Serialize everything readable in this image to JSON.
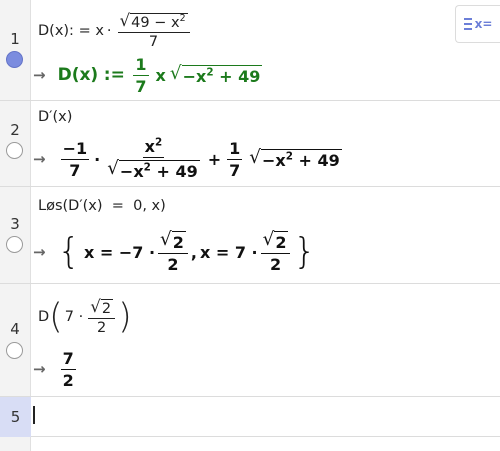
{
  "toolbar": {
    "toggle_label": "x="
  },
  "rows": [
    {
      "number": "1",
      "input": {
        "prefix": "D(x):",
        "eq": "=",
        "x": "x",
        "dot": "·",
        "sqrt_body": "49 − x",
        "sqrt_exp": "2",
        "den": "7"
      },
      "output": {
        "lhs": "D(x)",
        "assign": ":=",
        "num": "1",
        "den": "7",
        "x": "x",
        "sqrt_body": "−x",
        "sqrt_exp": "2",
        "sqrt_tail": " + 49"
      }
    },
    {
      "number": "2",
      "input": {
        "text": "D′(x)"
      },
      "output": {
        "num1": "−1",
        "den1": "7",
        "dot": "·",
        "num2": "x",
        "num2_exp": "2",
        "den2_body": "−x",
        "den2_exp": "2",
        "den2_tail": " + 49",
        "plus": "+",
        "num3": "1",
        "den3": "7",
        "sqrt_body": "−x",
        "sqrt_exp": "2",
        "sqrt_tail": " + 49"
      }
    },
    {
      "number": "3",
      "input": {
        "text": "Løs(D′(x)  =  0, x)"
      },
      "output": {
        "open": "{",
        "a": "x = −7 ·",
        "sqrt1": "2",
        "den1": "2",
        "comma": ",",
        "b": "x = 7 ·",
        "sqrt2": "2",
        "den2": "2",
        "close": "}"
      }
    },
    {
      "number": "4",
      "input": {
        "fn": "D",
        "open": "(",
        "seven": "7 ·",
        "sqrt": "2",
        "den": "2",
        "close": ")"
      },
      "output": {
        "num": "7",
        "den": "2"
      }
    },
    {
      "number": "5"
    }
  ]
}
